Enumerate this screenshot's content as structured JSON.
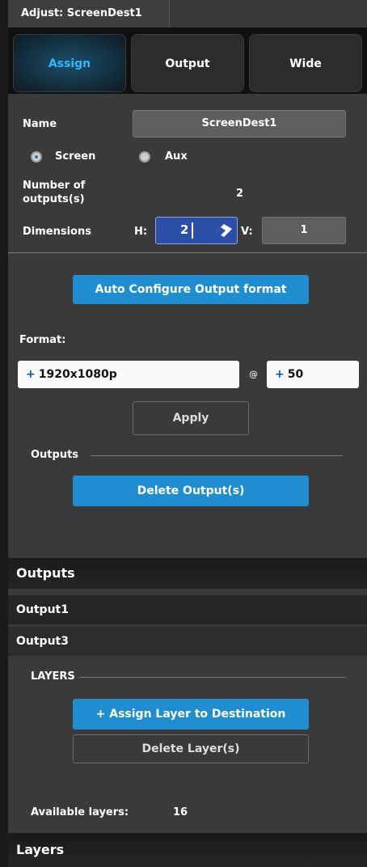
{
  "window": {
    "title": "Adjust: ScreenDest1"
  },
  "tabs": [
    {
      "label": "Assign",
      "active": true
    },
    {
      "label": "Output",
      "active": false
    },
    {
      "label": "Wide",
      "active": false
    }
  ],
  "form": {
    "name_label": "Name",
    "name_value": "ScreenDest1",
    "radio_screen": "Screen",
    "radio_aux": "Aux",
    "selected_type": "Screen",
    "num_outputs_label_line1": "Number of",
    "num_outputs_label_line2": "outputs(s)",
    "num_outputs_value": "2",
    "dimensions_label": "Dimensions",
    "h_label": "H:",
    "h_value": "2",
    "v_label": "V:",
    "v_value": "1"
  },
  "auto_configure_label": "Auto Configure Output format",
  "format": {
    "label": "Format:",
    "resolution": "1920x1080p",
    "at": "@",
    "rate": "50",
    "plus": "+",
    "apply_label": "Apply"
  },
  "outputs_section": {
    "label": "Outputs",
    "delete_label": "Delete Output(s)"
  },
  "outputs_list": {
    "header": "Outputs",
    "items": [
      "Output1",
      "Output3"
    ]
  },
  "layers_section": {
    "label": "LAYERS",
    "assign_label": "+ Assign Layer to Destination",
    "delete_label": "Delete Layer(s)",
    "available_label": "Available layers:",
    "available_value": "16"
  },
  "layers_header": "Layers",
  "colors": {
    "accent": "#1f8ed0",
    "active_tab_text": "#2fb5ff",
    "panel": "#3a3a3a"
  }
}
